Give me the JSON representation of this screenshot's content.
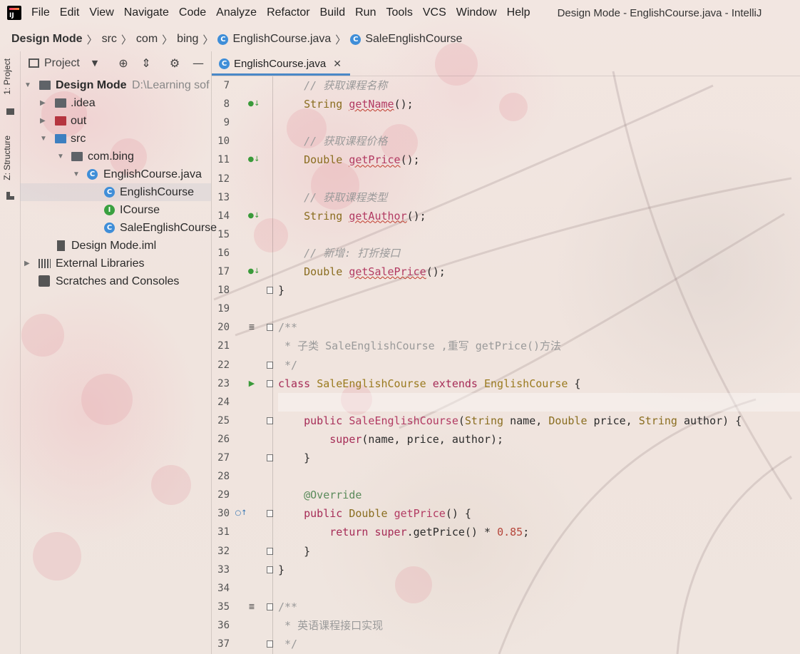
{
  "app": {
    "menus": [
      "File",
      "Edit",
      "View",
      "Navigate",
      "Code",
      "Analyze",
      "Refactor",
      "Build",
      "Run",
      "Tools",
      "VCS",
      "Window",
      "Help"
    ],
    "window_title": "Design Mode - EnglishCourse.java - IntelliJ"
  },
  "breadcrumb": {
    "project": "Design Mode",
    "src": "src",
    "com": "com",
    "bing": "bing",
    "file": "EnglishCourse.java",
    "cls": "SaleEnglishCourse"
  },
  "tool_strip": {
    "project_tab": "1: Project",
    "structure_tab": "Z: Structure"
  },
  "project_panel": {
    "title": "Project",
    "tree": [
      {
        "label": "Design Mode",
        "suffix": "D:\\Learning sof",
        "level": 0,
        "expanded": true,
        "icon": "folder-module-icon",
        "bold": true
      },
      {
        "label": ".idea",
        "level": 1,
        "expanded": false,
        "icon": "folder-icon"
      },
      {
        "label": "out",
        "level": 1,
        "expanded": false,
        "icon": "folder-excluded-icon"
      },
      {
        "label": "src",
        "level": 1,
        "expanded": true,
        "icon": "folder-source-icon"
      },
      {
        "label": "com.bing",
        "level": 2,
        "expanded": true,
        "icon": "package-icon"
      },
      {
        "label": "EnglishCourse.java",
        "level": 3,
        "expanded": true,
        "icon": "class-icon"
      },
      {
        "label": "EnglishCourse",
        "level": 4,
        "icon": "class-icon",
        "selected": true
      },
      {
        "label": "ICourse",
        "level": 4,
        "icon": "interface-icon"
      },
      {
        "label": "SaleEnglishCourse",
        "level": 4,
        "icon": "class-icon"
      },
      {
        "label": "Design Mode.iml",
        "level": 2,
        "icon": "module-file-icon"
      },
      {
        "label": "External Libraries",
        "level": 0,
        "expanded": false,
        "icon": "library-icon"
      },
      {
        "label": "Scratches and Consoles",
        "level": 0,
        "icon": "scratches-icon"
      }
    ]
  },
  "editor": {
    "tab_label": "EnglishCourse.java",
    "current_line": 24,
    "gutter": [
      {
        "n": 7
      },
      {
        "n": 8,
        "marker": "implemented"
      },
      {
        "n": 9
      },
      {
        "n": 10
      },
      {
        "n": 11,
        "marker": "implemented"
      },
      {
        "n": 12
      },
      {
        "n": 13
      },
      {
        "n": 14,
        "marker": "implemented"
      },
      {
        "n": 15
      },
      {
        "n": 16
      },
      {
        "n": 17,
        "marker": "implemented"
      },
      {
        "n": 18,
        "fold": true
      },
      {
        "n": 19
      },
      {
        "n": 20,
        "marker": "doc",
        "fold": true
      },
      {
        "n": 21
      },
      {
        "n": 22,
        "fold": true
      },
      {
        "n": 23,
        "marker": "run",
        "fold": true
      },
      {
        "n": 24
      },
      {
        "n": 25,
        "fold": true
      },
      {
        "n": 26
      },
      {
        "n": 27,
        "fold": true
      },
      {
        "n": 28
      },
      {
        "n": 29
      },
      {
        "n": 30,
        "marker": "override",
        "fold": true
      },
      {
        "n": 31
      },
      {
        "n": 32,
        "fold": true
      },
      {
        "n": 33,
        "fold": true
      },
      {
        "n": 34
      },
      {
        "n": 35,
        "marker": "doc",
        "fold": true
      },
      {
        "n": 36
      },
      {
        "n": 37,
        "fold": true
      }
    ],
    "lines": [
      {
        "n": 7,
        "tokens": [
          [
            "    ",
            ""
          ],
          [
            "// 获取课程名称",
            "cm"
          ]
        ]
      },
      {
        "n": 8,
        "tokens": [
          [
            "    ",
            ""
          ],
          [
            "String",
            "ty"
          ],
          [
            " ",
            ""
          ],
          [
            "getName",
            "fn-u"
          ],
          [
            "();",
            ""
          ]
        ]
      },
      {
        "n": 9,
        "tokens": []
      },
      {
        "n": 10,
        "tokens": [
          [
            "    ",
            ""
          ],
          [
            "// 获取课程价格",
            "cm"
          ]
        ]
      },
      {
        "n": 11,
        "tokens": [
          [
            "    ",
            ""
          ],
          [
            "Double",
            "ty"
          ],
          [
            " ",
            ""
          ],
          [
            "getPrice",
            "fn-u"
          ],
          [
            "();",
            ""
          ]
        ]
      },
      {
        "n": 12,
        "tokens": []
      },
      {
        "n": 13,
        "tokens": [
          [
            "    ",
            ""
          ],
          [
            "// 获取课程类型",
            "cm"
          ]
        ]
      },
      {
        "n": 14,
        "tokens": [
          [
            "    ",
            ""
          ],
          [
            "String",
            "ty"
          ],
          [
            " ",
            ""
          ],
          [
            "getAuthor",
            "fn-u"
          ],
          [
            "();",
            ""
          ]
        ]
      },
      {
        "n": 15,
        "tokens": []
      },
      {
        "n": 16,
        "tokens": [
          [
            "    ",
            ""
          ],
          [
            "// 新增: 打折接口",
            "cm"
          ]
        ]
      },
      {
        "n": 17,
        "tokens": [
          [
            "    ",
            ""
          ],
          [
            "Double",
            "ty"
          ],
          [
            " ",
            ""
          ],
          [
            "getSalePrice",
            "fn-u"
          ],
          [
            "();",
            ""
          ]
        ]
      },
      {
        "n": 18,
        "tokens": [
          [
            "}",
            ""
          ]
        ]
      },
      {
        "n": 19,
        "tokens": []
      },
      {
        "n": 20,
        "tokens": [
          [
            "/**",
            "cm-n"
          ]
        ]
      },
      {
        "n": 21,
        "tokens": [
          [
            " * 子类 SaleEnglishCourse ,重写 getPrice()方法",
            "cm-n"
          ]
        ]
      },
      {
        "n": 22,
        "tokens": [
          [
            " */",
            "cm-n"
          ]
        ]
      },
      {
        "n": 23,
        "tokens": [
          [
            "class",
            "kw"
          ],
          [
            " ",
            ""
          ],
          [
            "SaleEnglishCourse",
            "cl"
          ],
          [
            " ",
            ""
          ],
          [
            "extends",
            "kw"
          ],
          [
            " ",
            ""
          ],
          [
            "EnglishCourse",
            "cl"
          ],
          [
            " {",
            ""
          ]
        ]
      },
      {
        "n": 24,
        "tokens": []
      },
      {
        "n": 25,
        "tokens": [
          [
            "    ",
            ""
          ],
          [
            "public",
            "kw"
          ],
          [
            " ",
            ""
          ],
          [
            "SaleEnglishCourse",
            "fn"
          ],
          [
            "(",
            ""
          ],
          [
            "String",
            "ty"
          ],
          [
            " name, ",
            ""
          ],
          [
            "Double",
            "ty"
          ],
          [
            " price, ",
            ""
          ],
          [
            "String",
            "ty"
          ],
          [
            " author) {",
            ""
          ]
        ]
      },
      {
        "n": 26,
        "tokens": [
          [
            "        ",
            ""
          ],
          [
            "super",
            "kw"
          ],
          [
            "(name, price, author);",
            ""
          ]
        ]
      },
      {
        "n": 27,
        "tokens": [
          [
            "    }",
            ""
          ]
        ]
      },
      {
        "n": 28,
        "tokens": []
      },
      {
        "n": 29,
        "tokens": [
          [
            "    ",
            ""
          ],
          [
            "@Override",
            "an"
          ]
        ]
      },
      {
        "n": 30,
        "tokens": [
          [
            "    ",
            ""
          ],
          [
            "public",
            "kw"
          ],
          [
            " ",
            ""
          ],
          [
            "Double",
            "ty"
          ],
          [
            " ",
            ""
          ],
          [
            "getPrice",
            "fn"
          ],
          [
            "() {",
            ""
          ]
        ]
      },
      {
        "n": 31,
        "tokens": [
          [
            "        ",
            ""
          ],
          [
            "return",
            "kw"
          ],
          [
            " ",
            ""
          ],
          [
            "super",
            "kw"
          ],
          [
            ".getPrice() * ",
            ""
          ],
          [
            "0.85",
            "num"
          ],
          [
            ";",
            ""
          ]
        ]
      },
      {
        "n": 32,
        "tokens": [
          [
            "    }",
            ""
          ]
        ]
      },
      {
        "n": 33,
        "tokens": [
          [
            "}",
            ""
          ]
        ]
      },
      {
        "n": 34,
        "tokens": []
      },
      {
        "n": 35,
        "tokens": [
          [
            "/**",
            "cm-n"
          ]
        ]
      },
      {
        "n": 36,
        "tokens": [
          [
            " * 英语课程接口实现",
            "cm-n"
          ]
        ]
      },
      {
        "n": 37,
        "tokens": [
          [
            " */",
            "cm-n"
          ]
        ]
      }
    ]
  },
  "colors": {
    "accent": "#4a88c7",
    "keyword": "#a62c57",
    "type": "#8a6d1f",
    "comment": "#9a9a9a"
  }
}
